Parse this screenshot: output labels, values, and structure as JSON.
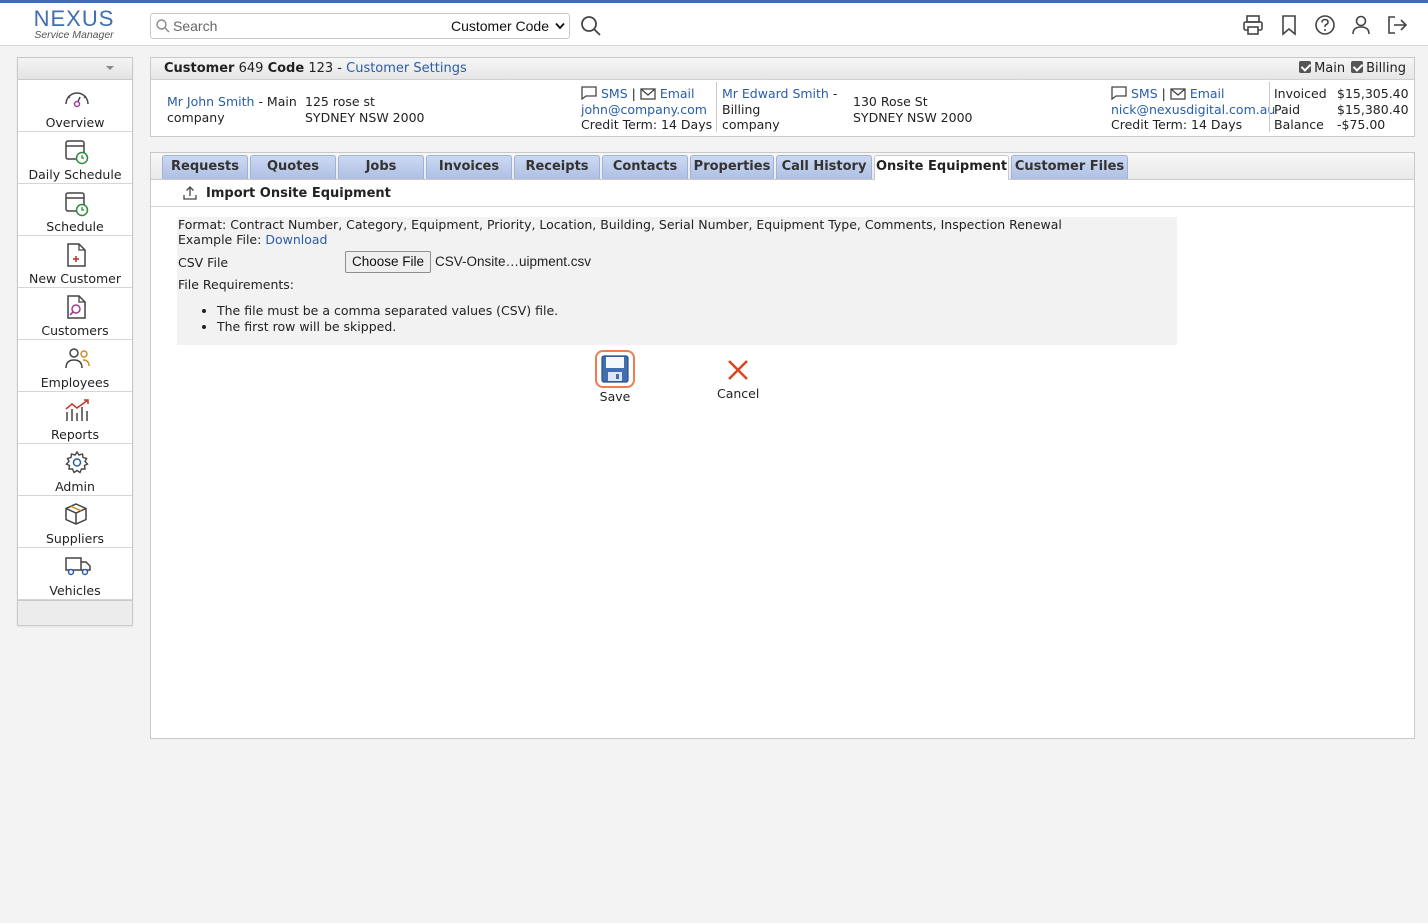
{
  "brand": {
    "name": "NEXUS",
    "sub": "Service Manager"
  },
  "search": {
    "placeholder": "Search",
    "mode": "Customer Code"
  },
  "sidebar": {
    "items": [
      {
        "label": "Overview",
        "icon": "gauge-icon"
      },
      {
        "label": "Daily Schedule",
        "icon": "calendar-clock-icon"
      },
      {
        "label": "Schedule",
        "icon": "calendar-clock-icon"
      },
      {
        "label": "New Customer",
        "icon": "file-plus-icon"
      },
      {
        "label": "Customers",
        "icon": "file-search-icon"
      },
      {
        "label": "Employees",
        "icon": "people-icon"
      },
      {
        "label": "Reports",
        "icon": "chart-icon"
      },
      {
        "label": "Admin",
        "icon": "gear-icon"
      },
      {
        "label": "Suppliers",
        "icon": "box-icon"
      },
      {
        "label": "Vehicles",
        "icon": "truck-icon"
      }
    ]
  },
  "customer": {
    "label": "Customer",
    "number": "649",
    "code_label": "Code",
    "code": "123",
    "sep": "-",
    "settings_link": "Customer Settings",
    "toggle_main": "Main",
    "toggle_billing": "Billing",
    "main_contact": {
      "name": "Mr John Smith",
      "role": "- Main",
      "company": "company",
      "address1": "125 rose st",
      "address2": "SYDNEY NSW 2000",
      "sms": "SMS",
      "pipe": "|",
      "email_label": "Email",
      "email": "john@company.com",
      "credit": "Credit Term: 14 Days"
    },
    "billing_contact": {
      "name": "Mr Edward Smith",
      "dash": "-",
      "role": "Billing",
      "company": "company",
      "address1": "130 Rose St",
      "address2": "SYDNEY NSW 2000",
      "sms": "SMS",
      "pipe": "|",
      "email_label": "Email",
      "email": "nick@nexusdigital.com.au",
      "credit": "Credit Term: 14 Days"
    },
    "totals": {
      "invoiced_label": "Invoiced",
      "invoiced": "$15,305.40",
      "paid_label": "Paid",
      "paid": "$15,380.40",
      "balance_label": "Balance",
      "balance": "-$75.00"
    }
  },
  "tabs": [
    "Requests",
    "Quotes",
    "Jobs",
    "Invoices",
    "Receipts",
    "Contacts",
    "Properties",
    "Call History",
    "Onsite Equipment",
    "Customer Files"
  ],
  "active_tab": "Onsite Equipment",
  "import": {
    "title": "Import Onsite Equipment",
    "format": "Format: Contract Number, Category, Equipment, Priority, Location, Building, Serial Number, Equipment Type, Comments, Inspection Renewal",
    "example_label": "Example File:",
    "example_link": "Download",
    "csv_label": "CSV File",
    "choose_button": "Choose File",
    "file_name": "CSV-Onsite…uipment.csv",
    "requirements_label": "File Requirements:",
    "requirements": [
      "The file must be a comma separated values (CSV) file.",
      "The first row will be skipped."
    ],
    "save": "Save",
    "cancel": "Cancel"
  }
}
